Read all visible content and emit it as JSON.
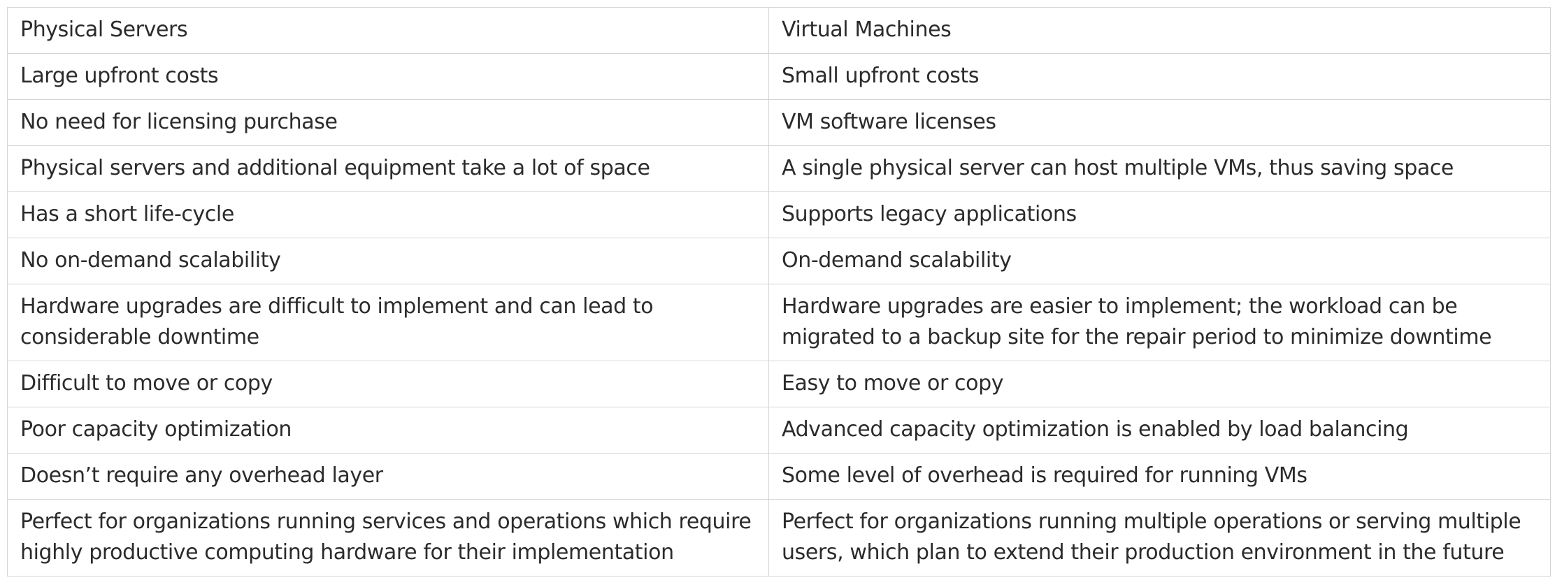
{
  "table": {
    "rows": [
      [
        "Physical Servers",
        "Virtual Machines"
      ],
      [
        "Large upfront costs",
        "Small upfront costs"
      ],
      [
        "No need for licensing purchase",
        "VM software licenses"
      ],
      [
        "Physical servers and additional equipment take a lot of space",
        "A single physical server can host multiple VMs, thus saving space"
      ],
      [
        "Has a short life-cycle",
        "Supports legacy applications"
      ],
      [
        "No on-demand scalability",
        "On-demand scalability"
      ],
      [
        "Hardware upgrades are difficult to implement and can lead to considerable downtime",
        "Hardware upgrades are easier to implement; the workload can be migrated to a backup site for the repair period to minimize downtime"
      ],
      [
        "Difficult to move or copy",
        "Easy to move or copy"
      ],
      [
        "Poor capacity optimization",
        "Advanced capacity optimization is enabled by load balancing"
      ],
      [
        "Doesn’t require any overhead layer",
        "Some level of overhead is required for running VMs"
      ],
      [
        "Perfect for organizations running services and operations which require highly productive computing hardware for their implementation",
        "Perfect for organizations running multiple operations or serving multiple users, which plan to extend their production environment in the future"
      ]
    ]
  }
}
